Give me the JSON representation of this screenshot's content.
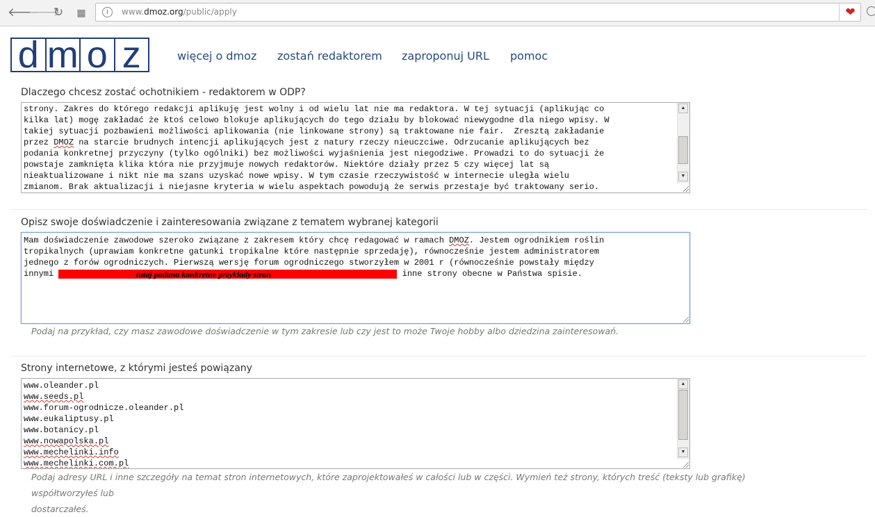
{
  "browser": {
    "url_prefix": "www.",
    "url_domain": "dmoz.org",
    "url_path": "/public/apply"
  },
  "site": {
    "logo_letters": [
      "d",
      "m",
      "o",
      "z"
    ],
    "nav": [
      "więcej o dmoz",
      "zostań redaktorem",
      "zaproponuj URL",
      "pomoc"
    ]
  },
  "section1": {
    "label": "Dlaczego chcesz zostać ochotnikiem - redaktorem w ODP?",
    "lines": [
      "strony. Zakres do którego redakcji aplikuję jest wolny i od wielu lat nie ma redaktora. W tej sytuacji (aplikując co",
      "kilka lat) mogę zakładać że ktoś celowo blokuje aplikujących do tego działu by blokować niewygodne dla niego wpisy. W",
      "takiej sytuacji pozbawieni możliwości aplikowania (nie linkowane strony) są traktowane nie fair.  Zresztą zakładanie",
      "przez ",
      " na starcie brudnych intencji aplikujących jest z natury rzeczy nieuczciwe. Odrzucanie aplikujących bez",
      "podania konkretnej przyczyny (tylko ogólniki) bez możliwości wyjaśnienia jest niegodziwe. Prowadzi to do sytuacji że",
      "powstaje zamknięta klika która nie przyjmuje nowych redaktorów. Niektóre działy przez 5 czy więcej lat są",
      "nieaktualizowane i nikt nie ma szans uzyskać nowe wpisy. W tym czasie rzeczywistość w internecie uległa wielu",
      "zmianom. Brak aktualizacji i niejasne kryteria w wielu aspektach powodują że serwis przestaje być traktowany serio."
    ],
    "dmoz": "DMOZ"
  },
  "section2": {
    "label": "Opisz swoje doświadczenie i zainteresowania związane z tematem wybranej kategorii",
    "line1a": "Mam doświadczenie zawodowe szeroko związane z zakresem który chcę redagować w ramach ",
    "line1b": ". Jestem ogrodnikiem roślin",
    "dmoz": "DMOZ",
    "line2": "tropikalnych (uprawiam konkretne gatunki tropikalne które następnie sprzedaję), równocześnie jestem administratorem",
    "line3": "jednego z forów ogrodniczych. Pierwszą wersję forum ogrodniczego stworzyłem w 2001 r (równocześnie powstały między",
    "line4a": "innymi ",
    "redacted_note": "tutaj podano konkretne przykłady stron",
    "line4b": " inne strony obecne w Państwa spisie.",
    "hint": "Podaj na przykład, czy masz zawodowe doświadczenie w tym zakresie lub czy jest to może Twoje hobby albo dziedzina zainteresowań."
  },
  "section3": {
    "label": "Strony internetowe, z którymi jesteś powiązany",
    "sites": [
      "www.oleander.pl",
      "www.seeds.pl",
      "www.forum-ogrodnicze.oleander.pl",
      "www.eukaliptusy.pl",
      "www.botanicy.pl",
      "www.nowapolska.pl",
      "www.mechelinki.info",
      "www.mechelinki.com.pl"
    ],
    "hint_line1": "Podaj adresy URL i inne szczegóły na temat stron internetowych, które zaprojektowałeś w całości lub w części. Wymień też strony, których treść (teksty lub grafikę) współtworzyłeś lub",
    "hint_line2": "dostarczałeś."
  }
}
